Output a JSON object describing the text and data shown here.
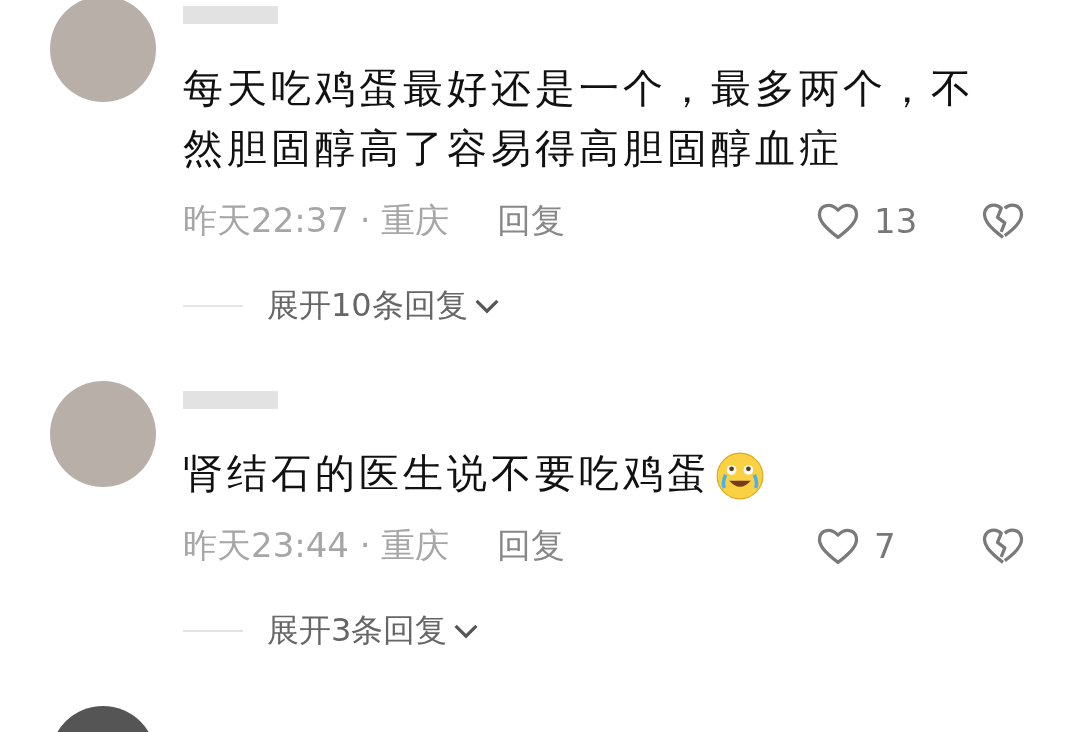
{
  "comments": [
    {
      "text": "每天吃鸡蛋最好还是一个，最多两个，不然胆固醇高了容易得高胆固醇血症",
      "emoji": false,
      "time": "昨天22:37",
      "separator": "·",
      "location": "重庆",
      "reply": "回复",
      "likes": "13",
      "expand": "展开10条回复"
    },
    {
      "text": "肾结石的医生说不要吃鸡蛋",
      "emoji": true,
      "time": "昨天23:44",
      "separator": "·",
      "location": "重庆",
      "reply": "回复",
      "likes": "7",
      "expand": "展开3条回复"
    }
  ]
}
